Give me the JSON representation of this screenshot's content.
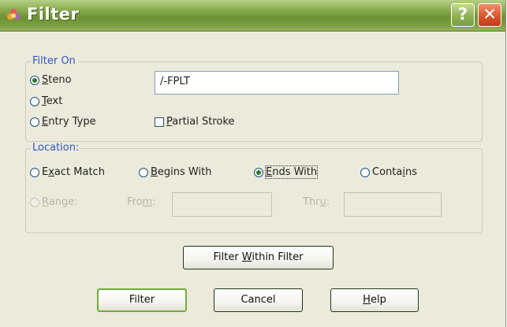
{
  "background": {
    "char_paren": "(",
    "char_e": "e"
  },
  "window": {
    "title": "Filter",
    "help_button": "?",
    "close_button": "✕"
  },
  "filter_on": {
    "legend": "Filter On",
    "options": [
      {
        "label": "Steno",
        "mnemonic": "S",
        "selected": true
      },
      {
        "label": "Text",
        "mnemonic": "T",
        "selected": false
      },
      {
        "label": "Entry Type",
        "mnemonic": "E",
        "selected": false
      }
    ],
    "value": "/-FPLT",
    "partial_stroke_label": "Partial Stroke",
    "partial_stroke_checked": false
  },
  "location": {
    "legend": "Location:",
    "options": [
      {
        "label": "Exact Match",
        "selected": false
      },
      {
        "label": "Begins With",
        "selected": false
      },
      {
        "label": "Ends With",
        "selected": true
      },
      {
        "label": "Contains",
        "selected": false
      }
    ],
    "range_label": "Range:",
    "from_label": "From:",
    "thru_label": "Thru:",
    "from_value": "",
    "thru_value": ""
  },
  "buttons": {
    "filter_within": "Filter Within Filter",
    "filter": "Filter",
    "cancel": "Cancel",
    "help": "Help"
  },
  "colors": {
    "accent_green": "#6c9033",
    "legend_blue": "#2f57c9",
    "close_red": "#d8542d"
  }
}
